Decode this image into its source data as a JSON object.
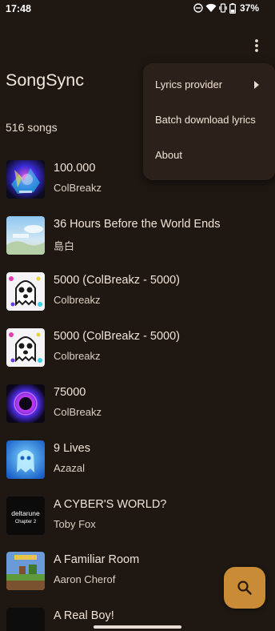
{
  "status": {
    "time": "17:48",
    "battery": "37%"
  },
  "app": {
    "title": "SongSync",
    "song_count": "516 songs"
  },
  "menu": {
    "items": [
      {
        "label": "Lyrics provider",
        "has_submenu": true
      },
      {
        "label": "Batch download lyrics"
      },
      {
        "label": "About"
      }
    ]
  },
  "songs": [
    {
      "title": "100.000",
      "artist": "ColBreakz"
    },
    {
      "title": "36 Hours Before the World Ends",
      "artist": "島白"
    },
    {
      "title": "5000 (ColBreakz - 5000)",
      "artist": "Colbreakz"
    },
    {
      "title": "5000 (ColBreakz - 5000)",
      "artist": "Colbreakz"
    },
    {
      "title": "75000",
      "artist": "ColBreakz"
    },
    {
      "title": "9 Lives",
      "artist": "Azazal"
    },
    {
      "title": "A CYBER'S WORLD?",
      "artist": "Toby Fox",
      "art_text": "deltarune",
      "art_subtext": "Chapter 2"
    },
    {
      "title": "A Familiar Room",
      "artist": "Aaron Cherof"
    },
    {
      "title": "A Real Boy!",
      "artist": ""
    }
  ],
  "colors": {
    "background": "#1e1712",
    "menu": "#2c211a",
    "fab": "#c98b35"
  }
}
